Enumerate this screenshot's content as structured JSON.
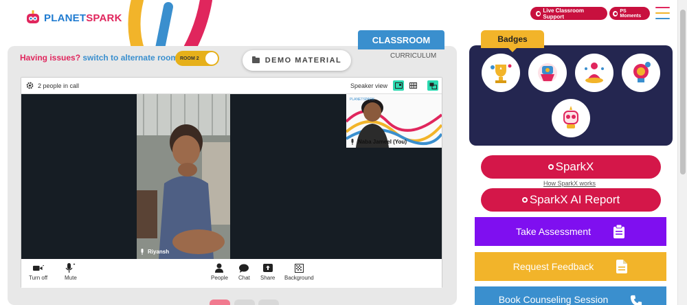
{
  "header": {
    "logo_left": "PLANET",
    "logo_right": "SPARK",
    "live_support_label": "Live Classroom Support",
    "ps_moments_label": "PS Moments"
  },
  "tabs": {
    "classroom_label": "CLASSROOM",
    "curriculum_label": "CURRICULUM"
  },
  "issue_bar": {
    "issues_text": "Having issues?",
    "switch_text": "switch to alternate room",
    "room_label": "ROOM 2",
    "demo_material_label": "DEMO MATERIAL"
  },
  "call": {
    "people_count": "2 people in call",
    "view_mode": "Speaker view",
    "main_participant": "Riyansh",
    "thumb_participant": "Naba Jameel (You)",
    "controls": [
      {
        "label": "Turn off",
        "icon": "camera-icon"
      },
      {
        "label": "Mute",
        "icon": "microphone-icon"
      },
      {
        "label": "People",
        "icon": "person-icon"
      },
      {
        "label": "Chat",
        "icon": "chat-icon"
      },
      {
        "label": "Share",
        "icon": "share-icon"
      },
      {
        "label": "Background",
        "icon": "background-icon"
      }
    ]
  },
  "badges": {
    "title": "Badges",
    "items": [
      "trophy-badge",
      "hands-badge",
      "meditation-badge",
      "lightbulb-badge",
      "robot-badge"
    ]
  },
  "actions": {
    "sparkx_label": "SparkX",
    "how_sparkx_label": "How SparkX works",
    "sparkx_report_label": "SparkX AI Report",
    "take_assessment_label": "Take Assessment",
    "request_feedback_label": "Request Feedback",
    "book_counseling_label": "Book Counseling Session"
  },
  "colors": {
    "accent_red": "#d41749",
    "brand_blue": "#3a8fce",
    "purple": "#7f0ff0",
    "amber": "#f2b42a",
    "navy": "#242650"
  }
}
